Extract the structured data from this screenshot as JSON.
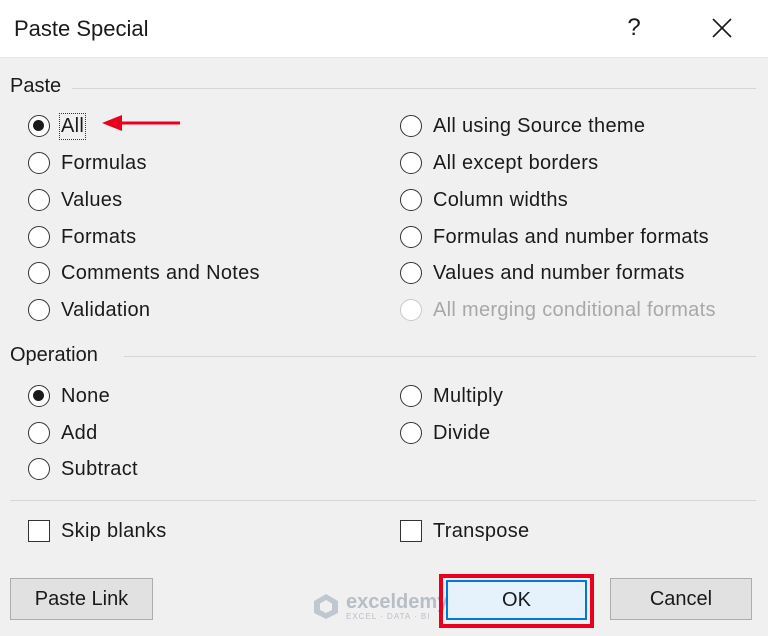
{
  "title": "Paste Special",
  "title_buttons": {
    "help": "?"
  },
  "paste": {
    "label": "Paste",
    "options_left": [
      {
        "label": "All",
        "checked": true
      },
      {
        "label": "Formulas",
        "checked": false
      },
      {
        "label": "Values",
        "checked": false
      },
      {
        "label": "Formats",
        "checked": false
      },
      {
        "label": "Comments and Notes",
        "checked": false
      },
      {
        "label": "Validation",
        "checked": false
      }
    ],
    "options_right": [
      {
        "label": "All using Source theme",
        "checked": false
      },
      {
        "label": "All except borders",
        "checked": false
      },
      {
        "label": "Column widths",
        "checked": false
      },
      {
        "label": "Formulas and number formats",
        "checked": false
      },
      {
        "label": "Values and number formats",
        "checked": false
      },
      {
        "label": "All merging conditional formats",
        "checked": false,
        "disabled": true
      }
    ]
  },
  "operation": {
    "label": "Operation",
    "options_left": [
      {
        "label": "None",
        "checked": true
      },
      {
        "label": "Add",
        "checked": false
      },
      {
        "label": "Subtract",
        "checked": false
      }
    ],
    "options_right": [
      {
        "label": "Multiply",
        "checked": false
      },
      {
        "label": "Divide",
        "checked": false
      }
    ]
  },
  "checkboxes": {
    "skip_blanks": "Skip blanks",
    "transpose": "Transpose"
  },
  "buttons": {
    "paste_link": "Paste Link",
    "ok": "OK",
    "cancel": "Cancel"
  },
  "watermark": {
    "name": "exceldemy",
    "tagline": "EXCEL · DATA · BI"
  },
  "colors": {
    "annotation_red": "#e8001c",
    "focus_blue": "#0078d7",
    "disabled_gray": "#a8a8a8"
  }
}
